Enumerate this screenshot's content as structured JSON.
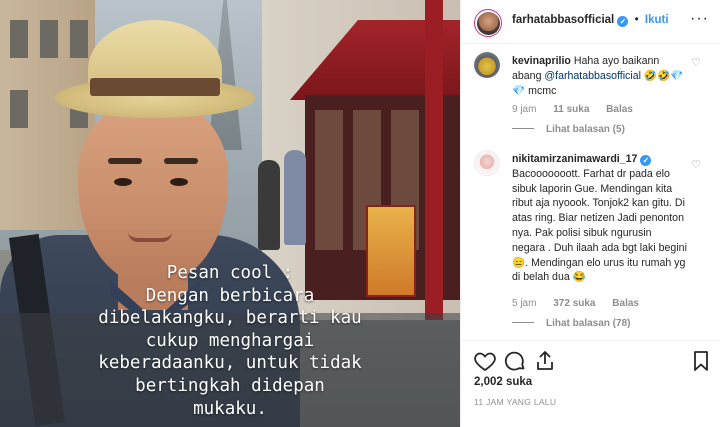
{
  "photo": {
    "caption": "Pesan cool :\nDengan berbicara\ndibelakangku, berarti kau\ncukup menghargai\nkeberadaanku, untuk tidak\nbertingkah didepan\nmukaku."
  },
  "post": {
    "owner": "farhatabbasofficial",
    "follow_label": "Ikuti",
    "separator": "•",
    "more_icon": "more-horizontal-icon",
    "likes": "2,002 suka",
    "timestamp": "11 JAM YANG LALU"
  },
  "comments": [
    {
      "username": "kevinaprilio",
      "text_before": "Haha ayo baikann abang ",
      "mention": "@farhatabbasofficial",
      "text_after": " 🤣🤣💎💎 mcmc",
      "time": "9 jam",
      "likes": "11 suka",
      "reply_label": "Balas",
      "view_replies": "Lihat balasan (5)"
    },
    {
      "username": "nikitamirzanimawardi_17",
      "text": "Bacooooooott. Farhat dr pada elo sibuk laporin Gue. Mendingan kita ribut aja nyoook. Tonjok2 kan gitu. Di atas ring. Biar netizen Jadi penonton nya. Pak polisi sibuk ngurusin negara . Duh ilaah ada bgt laki begini 😑. Mendingan elo urus itu rumah yg di belah dua 😂",
      "time": "5 jam",
      "likes": "372 suka",
      "reply_label": "Balas",
      "view_replies": "Lihat balasan (78)"
    }
  ],
  "colors": {
    "accent_blue": "#3897f0",
    "text": "#262626",
    "muted": "#8e8e8e",
    "border": "#efefef"
  },
  "icons": {
    "like": "heart-icon",
    "comment": "comment-icon",
    "share": "share-icon",
    "save": "bookmark-icon",
    "comment_like": "heart-small-icon",
    "verified": "verified-badge-icon"
  }
}
